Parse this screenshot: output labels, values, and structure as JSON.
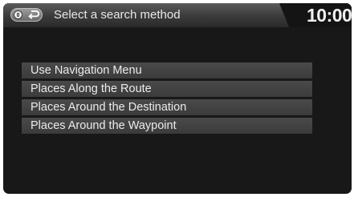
{
  "header": {
    "title": "Select a search method",
    "clock": "10:00",
    "home_icon": "home-icon",
    "back_icon": "back-arrow-icon"
  },
  "menu": {
    "items": [
      {
        "label": "Use Navigation Menu"
      },
      {
        "label": "Places Along the Route"
      },
      {
        "label": "Places Around the Destination"
      },
      {
        "label": "Places Around the Waypoint"
      }
    ]
  }
}
